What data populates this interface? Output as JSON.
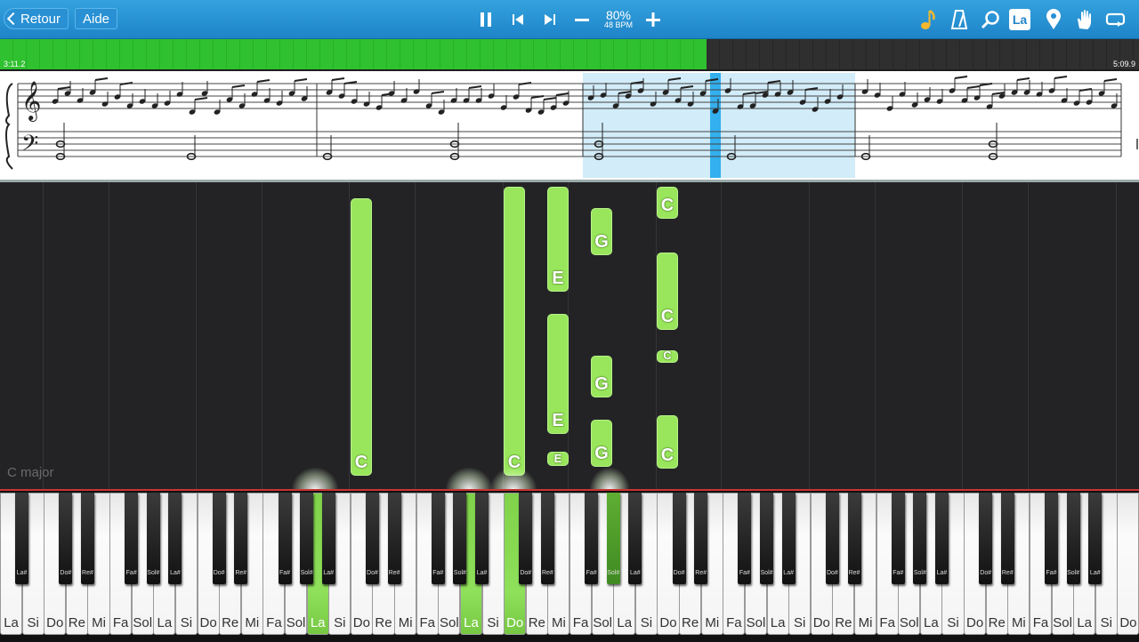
{
  "toolbar": {
    "back_label": "Retour",
    "help_label": "Aide",
    "speed_percent": "80%",
    "speed_bpm": "48 BPM",
    "note_label_button": "La"
  },
  "progress": {
    "elapsed": "3:11.2",
    "total": "5:09.9",
    "fraction": 0.62
  },
  "roll": {
    "key_signature": "C major",
    "note_color": "#99e65c"
  },
  "keyboard": {
    "white_keys": [
      "La",
      "Si",
      "Do",
      "Re",
      "Mi",
      "Fa",
      "Sol",
      "La",
      "Si",
      "Do",
      "Re",
      "Mi",
      "Fa",
      "Sol",
      "La",
      "Si",
      "Do",
      "Re",
      "Mi",
      "Fa",
      "Sol",
      "La",
      "Si",
      "Do",
      "Re",
      "Mi",
      "Fa",
      "Sol",
      "La",
      "Si",
      "Do",
      "Re",
      "Mi",
      "Fa",
      "Sol",
      "La",
      "Si",
      "Do",
      "Re",
      "Mi",
      "Fa",
      "Sol",
      "La",
      "Si",
      "Do",
      "Re",
      "Mi",
      "Fa",
      "Sol",
      "La",
      "Si",
      "Do"
    ],
    "active_white_keys": [
      14,
      21,
      23
    ],
    "active_black_keys": [
      19
    ],
    "black_labels": [
      "La#",
      "Do#",
      "Re#",
      "Fa#",
      "Sol#"
    ]
  },
  "falling_notes": [
    {
      "label": "C"
    },
    {
      "label": "C"
    },
    {
      "label": "E"
    },
    {
      "label": "E"
    },
    {
      "label": "E"
    },
    {
      "label": "G"
    },
    {
      "label": "G"
    },
    {
      "label": "G"
    },
    {
      "label": "C"
    },
    {
      "label": "C"
    },
    {
      "label": "C"
    },
    {
      "label": "C"
    }
  ]
}
